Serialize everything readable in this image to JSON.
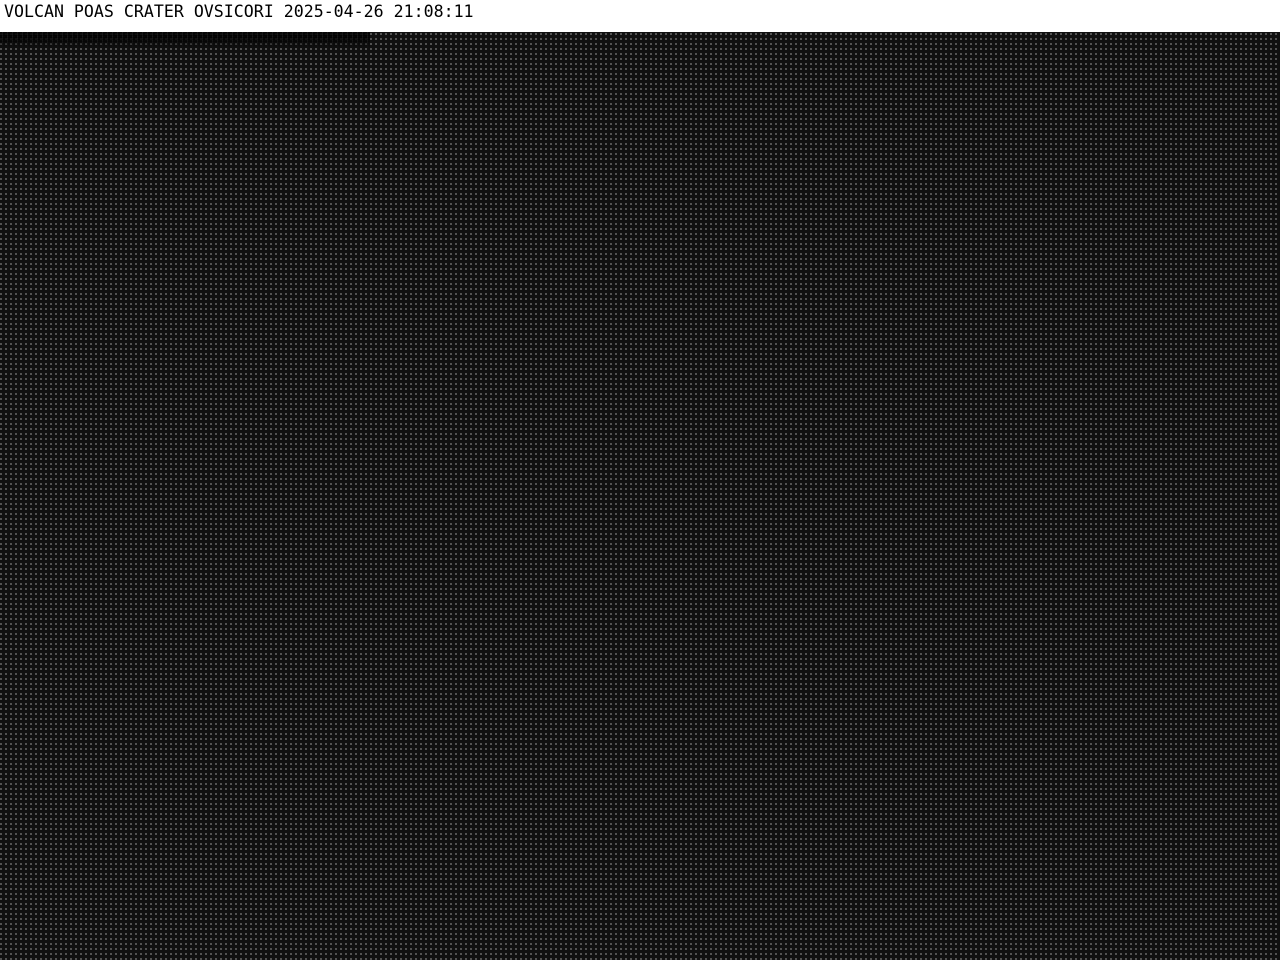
{
  "caption": {
    "text": "VOLCAN POAS CRATER OVSICORI 2025-04-26 21:08:11"
  },
  "colors": {
    "caption_background": "#ffffff",
    "caption_text": "#000000",
    "image_background": "#101010",
    "noise_dots": "#cdcdcd"
  }
}
